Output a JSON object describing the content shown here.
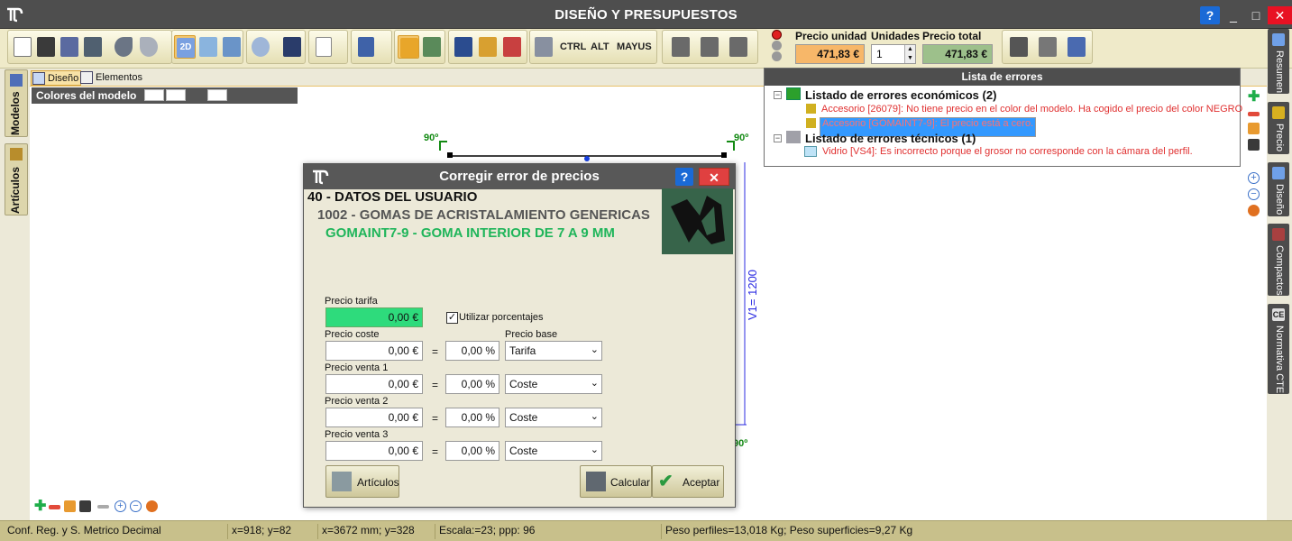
{
  "window": {
    "title": "DISEÑO Y PRESUPUESTOS",
    "help": "?",
    "minimize": "_",
    "maximize": "□",
    "close": "✕"
  },
  "toolbar": {
    "ctrl": "CTRL",
    "alt": "ALT",
    "mayus": "MAYUS",
    "view2d": "2D"
  },
  "price": {
    "unit_label": "Precio unidad",
    "unit_value": "471,83 €",
    "units_label": "Unidades",
    "units_value": "1",
    "total_label": "Precio total",
    "total_value": "471,83 €"
  },
  "left_tabs": [
    "Modelos",
    "Artículos"
  ],
  "right_tabs": [
    "Resumen",
    "Precio",
    "Diseño",
    "Compactos",
    "Normativa CTE"
  ],
  "design_tabs": [
    "Diseño",
    "Elementos"
  ],
  "colors_bar": {
    "label": "Colores del modelo"
  },
  "canvas": {
    "angle": "90º",
    "dimension_label": "V1= 1200"
  },
  "errors": {
    "title": "Lista de errores",
    "groups": [
      {
        "label": "Listado de errores económicos (2)",
        "items": [
          "Accesorio [26079]: No tiene precio en el color del modelo. Ha cogido el precio del color NEGRO",
          "Accesorio [GOMAINT7-9]: El precio está a cero."
        ]
      },
      {
        "label": "Listado de errores técnicos (1)",
        "items": [
          "Vidrio [VS4]: Es incorrecto porque el grosor no corresponde con la cámara del perfil."
        ]
      }
    ]
  },
  "dialog": {
    "title": "Corregir error de precios",
    "help": "?",
    "close": "✕",
    "line1": "40 - DATOS DEL USUARIO",
    "line2": "1002 - GOMAS DE ACRISTALAMIENTO GENERICAS",
    "line3": "GOMAINT7-9 - GOMA INTERIOR DE 7 A 9 MM",
    "tarifa_label": "Precio tarifa",
    "tarifa_value": "0,00 €",
    "use_pct_label": "Utilizar porcentajes",
    "use_pct_checked": "✓",
    "base_label": "Precio base",
    "equals": "=",
    "rows": [
      {
        "label": "Precio coste",
        "value": "0,00 €",
        "pct": "0,00 %",
        "base": "Tarifa"
      },
      {
        "label": "Precio venta 1",
        "value": "0,00 €",
        "pct": "0,00 %",
        "base": "Coste"
      },
      {
        "label": "Precio venta 2",
        "value": "0,00 €",
        "pct": "0,00 %",
        "base": "Coste"
      },
      {
        "label": "Precio venta 3",
        "value": "0,00 €",
        "pct": "0,00 %",
        "base": "Coste"
      }
    ],
    "btn_articulos": "Artículos",
    "btn_calcular": "Calcular",
    "btn_aceptar": "Aceptar"
  },
  "status": {
    "conf": "Conf. Reg. y S. Metrico Decimal",
    "xy": "x=918; y=82",
    "mm": "x=3672 mm; y=328",
    "scale": "Escala:=23; ppp: 96",
    "weights": "Peso perfiles=13,018 Kg; Peso superficies=9,27 Kg"
  }
}
